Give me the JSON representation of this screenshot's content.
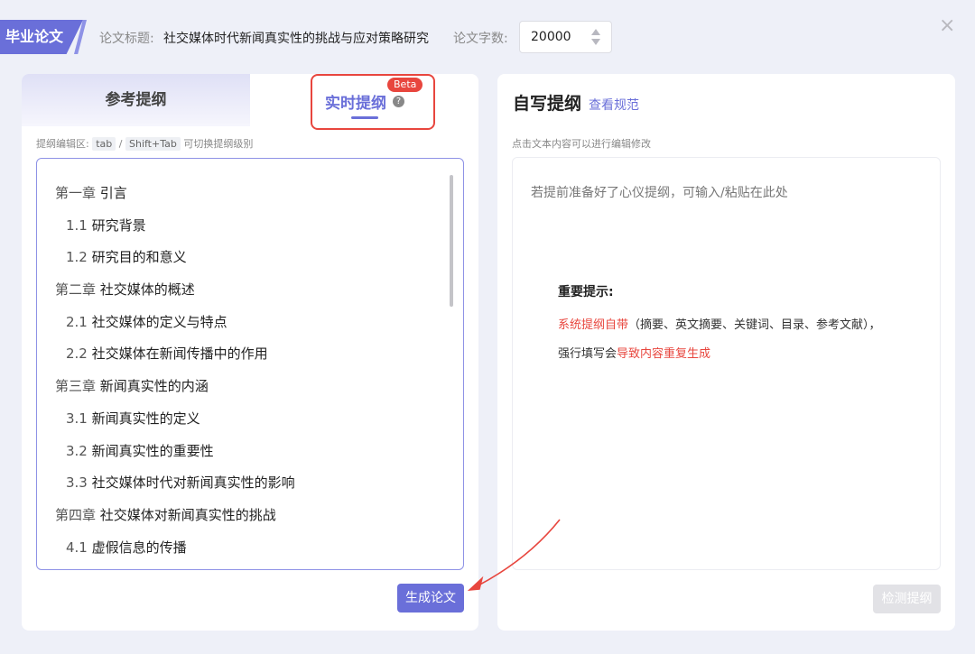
{
  "header": {
    "tag": "毕业论文",
    "title_label": "论文标题:",
    "title_value": "社交媒体时代新闻真实性的挑战与应对策略研究",
    "word_count_label": "论文字数:",
    "word_count_value": "20000",
    "close": "×"
  },
  "left_panel": {
    "tabs": {
      "reference": "参考提纲",
      "live": "实时提纲",
      "beta": "Beta",
      "help": "?"
    },
    "hint": {
      "prefix": "提纲编辑区:",
      "key1": "tab",
      "sep": "/",
      "key2": "Shift+Tab",
      "suffix": "可切换提纲级别"
    },
    "outline": [
      {
        "level": 1,
        "num": "第一章",
        "text": "引言"
      },
      {
        "level": 2,
        "num": "1.1",
        "text": "研究背景"
      },
      {
        "level": 2,
        "num": "1.2",
        "text": "研究目的和意义"
      },
      {
        "level": 1,
        "num": "第二章",
        "text": "社交媒体的概述"
      },
      {
        "level": 2,
        "num": "2.1",
        "text": "社交媒体的定义与特点"
      },
      {
        "level": 2,
        "num": "2.2",
        "text": "社交媒体在新闻传播中的作用"
      },
      {
        "level": 1,
        "num": "第三章",
        "text": "新闻真实性的内涵"
      },
      {
        "level": 2,
        "num": "3.1",
        "text": "新闻真实性的定义"
      },
      {
        "level": 2,
        "num": "3.2",
        "text": "新闻真实性的重要性"
      },
      {
        "level": 2,
        "num": "3.3",
        "text": "社交媒体时代对新闻真实性的影响"
      },
      {
        "level": 1,
        "num": "第四章",
        "text": "社交媒体对新闻真实性的挑战"
      },
      {
        "level": 2,
        "num": "4.1",
        "text": "虚假信息的传播"
      }
    ],
    "generate_button": "生成论文"
  },
  "right_panel": {
    "title": "自写提纲",
    "link": "查看规范",
    "hint": "点击文本内容可以进行编辑修改",
    "placeholder": "若提前准备好了心仪提纲，可输入/粘贴在此处",
    "important_title": "重要提示:",
    "line1_red": "系统提纲自带",
    "line1_rest": "（摘要、英文摘要、关键词、目录、参考文献），",
    "line2_prefix": "强行填写会",
    "line2_red": "导致内容重复生成",
    "check_button": "检测提纲"
  },
  "colors": {
    "accent": "#6a6fd9",
    "highlight": "#e8463e",
    "background": "#eef0f8"
  }
}
